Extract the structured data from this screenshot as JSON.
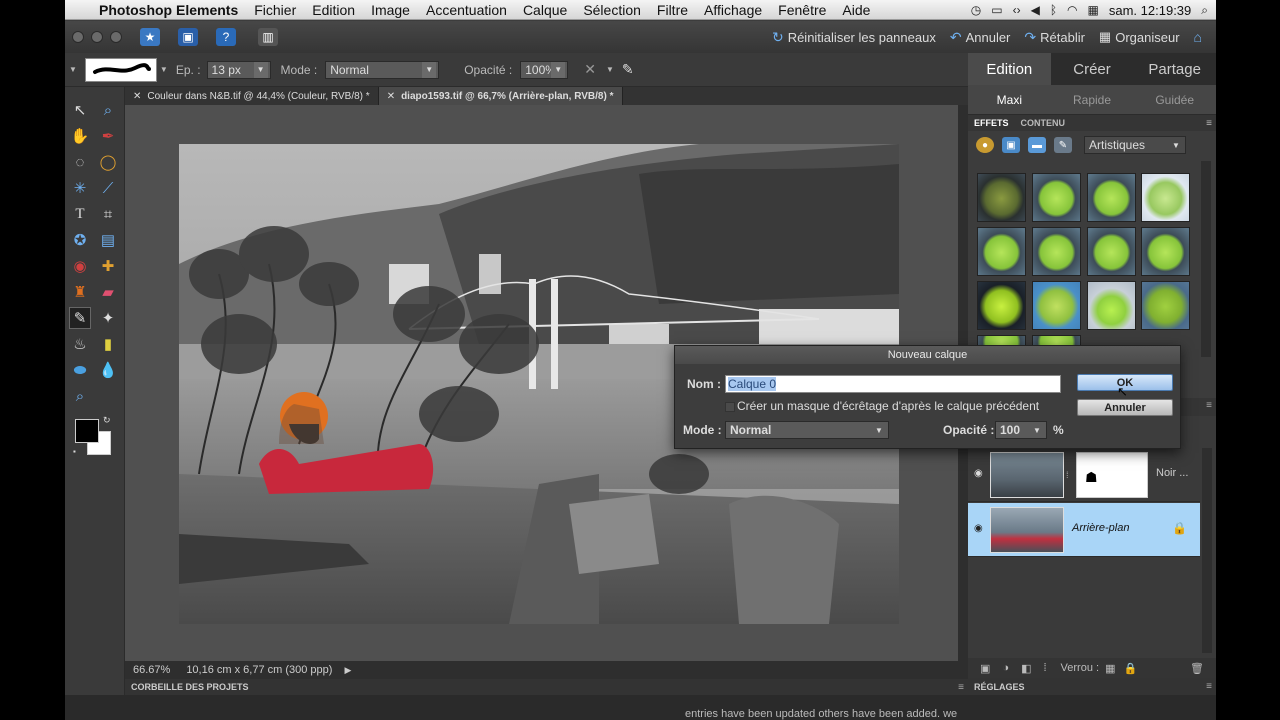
{
  "menubar": {
    "app": "Photoshop Elements",
    "items": [
      "Fichier",
      "Edition",
      "Image",
      "Accentuation",
      "Calque",
      "Sélection",
      "Filtre",
      "Affichage",
      "Fenêtre",
      "Aide"
    ],
    "clock": "sam. 12:19:39"
  },
  "appbar": {
    "reset": "Réinitialiser les panneaux",
    "undo": "Annuler",
    "redo": "Rétablir",
    "organizer": "Organiseur"
  },
  "options": {
    "size_label": "Ep. :",
    "size_value": "13 px",
    "mode_label": "Mode :",
    "mode_value": "Normal",
    "opacity_label": "Opacité :",
    "opacity_value": "100%"
  },
  "tabs": [
    {
      "label": "Couleur dans N&B.tif @ 44,4% (Couleur, RVB/8) *"
    },
    {
      "label": "diapo1593.tif @ 66,7% (Arrière-plan, RVB/8) *"
    }
  ],
  "status": {
    "zoom": "66.67%",
    "docsize": "10,16 cm x 6,77 cm (300 ppp)"
  },
  "bin_label": "CORBEILLE DES PROJETS",
  "panel": {
    "modes": [
      "Edition",
      "Créer",
      "Partage"
    ],
    "submodes": [
      "Maxi",
      "Rapide",
      "Guidée"
    ],
    "effects_tab": "EFFETS",
    "content_tab": "CONTENU",
    "effects_select": "Artistiques",
    "adjust_label": "RÉGLAGES"
  },
  "layers": [
    {
      "name": "Noir ...",
      "style": "normal"
    },
    {
      "name": "Arrière-plan",
      "style": "italic"
    }
  ],
  "layers_footer": {
    "lock_label": "Verrou :"
  },
  "dialog": {
    "title": "Nouveau calque",
    "name_label": "Nom :",
    "name_value": "Calque 0",
    "clip_label": "Créer un masque d'écrêtage d'après le calque précédent",
    "mode_label": "Mode :",
    "mode_value": "Normal",
    "opacity_label": "Opacité :",
    "opacity_value": "100",
    "percent": "%",
    "ok": "OK",
    "cancel": "Annuler"
  },
  "caption": "entries have been updated others have been added. we"
}
